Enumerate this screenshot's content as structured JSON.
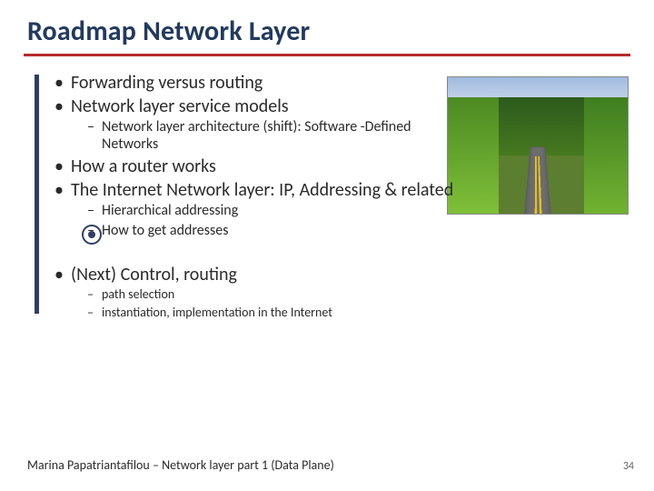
{
  "title": "Roadmap Network Layer",
  "image_alt": "road-photo",
  "bullets": {
    "b1": "Forwarding versus routing",
    "b2": "Network layer service models",
    "b2a": "Network layer architecture (shift): Software -Defined Networks",
    "b3": "How a router works",
    "b4": "The Internet Network layer: IP, Addressing & related",
    "b4a": "Hierarchical addressing",
    "b4b": "How to get addresses",
    "b5": "(Next) Control, routing",
    "b5a": "path selection",
    "b5b": "instantiation, implementation in the Internet"
  },
  "footer": "Marina Papatriantafilou –  Network layer part 1 (Data Plane)",
  "page_number": "34"
}
